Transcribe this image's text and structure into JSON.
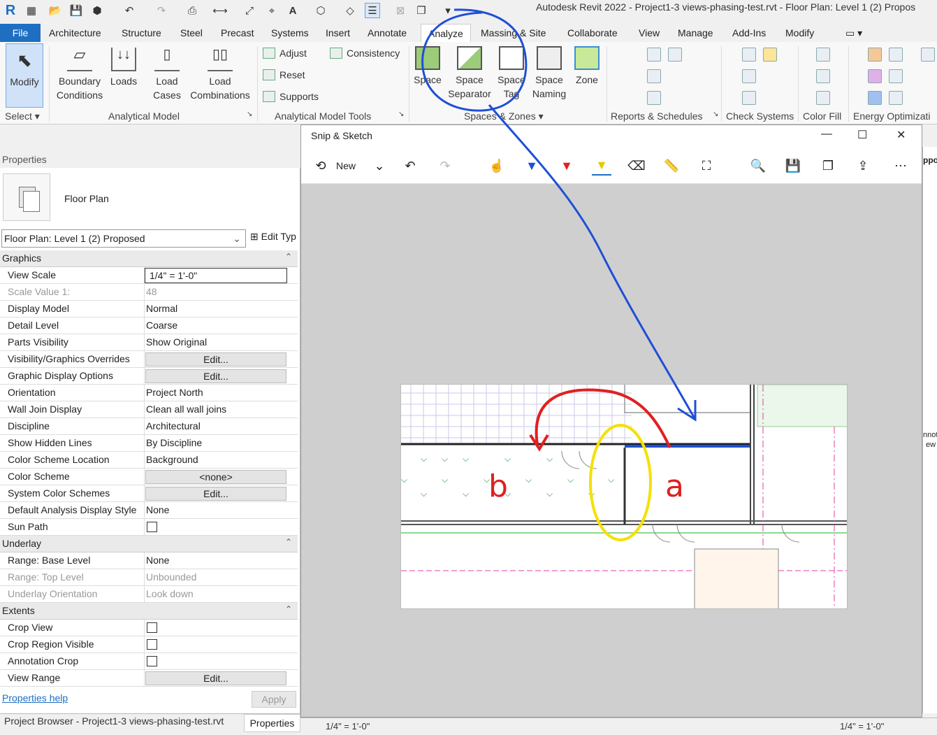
{
  "app": {
    "title": "Autodesk Revit 2022 - Project1-3 views-phasing-test.rvt - Floor Plan: Level 1 (2) Propos"
  },
  "tabs": [
    "File",
    "Architecture",
    "Structure",
    "Steel",
    "Precast",
    "Systems",
    "Insert",
    "Annotate",
    "Analyze",
    "Massing & Site",
    "Collaborate",
    "View",
    "Manage",
    "Add-Ins",
    "Modify"
  ],
  "ribbon": {
    "modify_label": "Modify",
    "select_label": "Select",
    "boundary_label_1": "Boundary",
    "boundary_label_2": "Conditions",
    "loads_label": "Loads",
    "load_cases_1": "Load",
    "load_cases_2": "Cases",
    "load_comb_1": "Load",
    "load_comb_2": "Combinations",
    "analytical_model": "Analytical Model",
    "adjust": "Adjust",
    "consistency": "Consistency",
    "reset": "Reset",
    "supports": "Supports",
    "analytical_tools": "Analytical Model Tools",
    "space": "Space",
    "space_sep_1": "Space",
    "space_sep_2": "Separator",
    "space_tag_1": "Space",
    "space_tag_2": "Tag",
    "space_naming_1": "Space",
    "space_naming_2": "Naming",
    "zone": "Zone",
    "spaces_zones": "Spaces & Zones",
    "reports": "Reports & Schedules",
    "check_systems": "Check Systems",
    "color_fill": "Color Fill",
    "energy": "Energy Optimizati"
  },
  "properties": {
    "header": "Properties",
    "type_name": "Floor Plan",
    "view_selector": "Floor Plan: Level 1 (2) Proposed",
    "edit_type": "Edit Typ",
    "help": "Properties help",
    "apply": "Apply",
    "groups": {
      "graphics": "Graphics",
      "underlay": "Underlay",
      "extents": "Extents"
    },
    "rows": [
      {
        "name": "View Scale",
        "value": "1/4\" = 1'-0\""
      },
      {
        "name": "Scale Value    1:",
        "value": "48"
      },
      {
        "name": "Display Model",
        "value": "Normal"
      },
      {
        "name": "Detail Level",
        "value": "Coarse"
      },
      {
        "name": "Parts Visibility",
        "value": "Show Original"
      },
      {
        "name": "Visibility/Graphics Overrides",
        "value": "Edit..."
      },
      {
        "name": "Graphic Display Options",
        "value": "Edit..."
      },
      {
        "name": "Orientation",
        "value": "Project North"
      },
      {
        "name": "Wall Join Display",
        "value": "Clean all wall joins"
      },
      {
        "name": "Discipline",
        "value": "Architectural"
      },
      {
        "name": "Show Hidden Lines",
        "value": "By Discipline"
      },
      {
        "name": "Color Scheme Location",
        "value": "Background"
      },
      {
        "name": "Color Scheme",
        "value": "<none>"
      },
      {
        "name": "System Color Schemes",
        "value": "Edit..."
      },
      {
        "name": "Default Analysis Display Style",
        "value": "None"
      },
      {
        "name": "Sun Path",
        "value": ""
      },
      {
        "name": "Range: Base Level",
        "value": "None"
      },
      {
        "name": "Range: Top Level",
        "value": "Unbounded"
      },
      {
        "name": "Underlay Orientation",
        "value": "Look down"
      },
      {
        "name": "Crop View",
        "value": ""
      },
      {
        "name": "Crop Region Visible",
        "value": ""
      },
      {
        "name": "Annotation Crop",
        "value": ""
      },
      {
        "name": "View Range",
        "value": "Edit..."
      }
    ]
  },
  "bottom_tabs": {
    "project_browser": "Project Browser - Project1-3 views-phasing-test.rvt",
    "properties": "Properties"
  },
  "snip": {
    "title": "Snip & Sketch",
    "new_label": "New",
    "annotation_a": "a",
    "annotation_b": "b"
  },
  "right_strip": {
    "text1": "ppo",
    "text2": "nnot",
    "text3": "ew"
  },
  "status": {
    "scale": "1/4\" = 1'-0\"",
    "scale2": "1/4\" = 1'-0\""
  },
  "colors": {
    "accent": "#1e6fc2",
    "blue_ink": "#1f4fd6",
    "red_ink": "#e02020",
    "yellow_ink": "#f5e000"
  }
}
